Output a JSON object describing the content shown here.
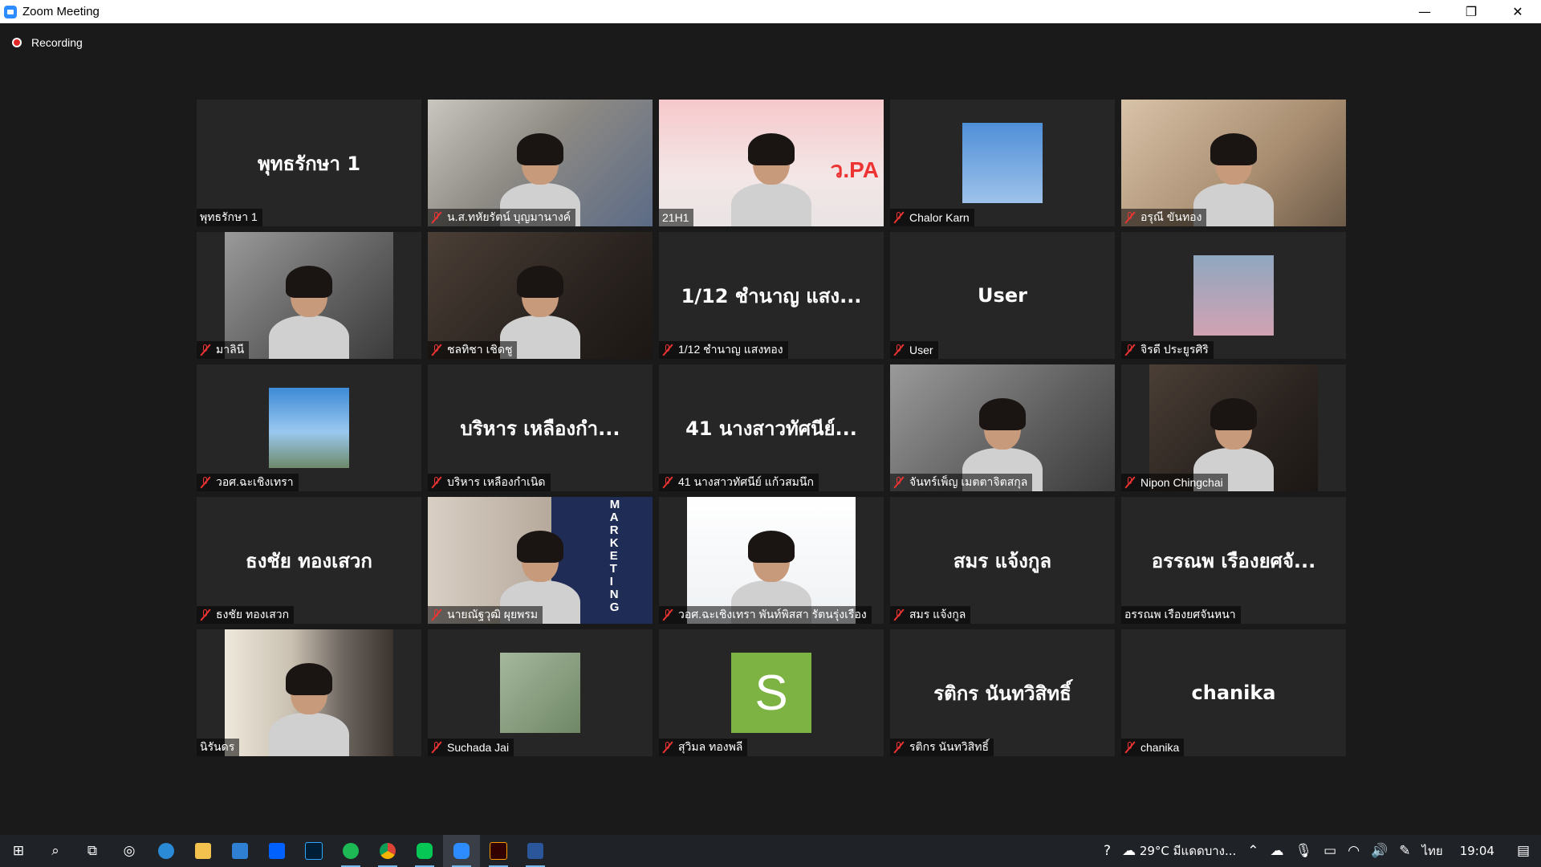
{
  "window": {
    "title": "Zoom Meeting",
    "minimize": "—",
    "restore": "❐",
    "close": "✕"
  },
  "recording": {
    "label": "Recording"
  },
  "tiles": [
    {
      "display": "พุทธรักษา 1",
      "label": "พุทธรักษา 1",
      "muted": false,
      "type": "name"
    },
    {
      "display": "",
      "label": "น.ส.ทหัยรัตน์ บุญมานางค์",
      "muted": true,
      "type": "video",
      "style": "v-room"
    },
    {
      "display": "",
      "label": "21H1",
      "muted": false,
      "type": "video",
      "style": "v-pink",
      "active": true,
      "slide_text": "ว.PA"
    },
    {
      "display": "",
      "label": "Chalor Karn",
      "muted": true,
      "type": "avatar",
      "style": "v-blue"
    },
    {
      "display": "",
      "label": "อรุณี ขันทอง",
      "muted": true,
      "type": "video",
      "style": "v-warm"
    },
    {
      "display": "",
      "label": "มาลินี",
      "muted": true,
      "type": "video",
      "style": "v-grey",
      "narrow": true
    },
    {
      "display": "",
      "label": "ชลทิชา เชิดชู",
      "muted": true,
      "type": "video",
      "style": "v-dark"
    },
    {
      "display": "1/12 ชำนาญ แสง...",
      "label": "1/12 ชำนาญ แสงทอง",
      "muted": true,
      "type": "name"
    },
    {
      "display": "User",
      "label": "User",
      "muted": true,
      "type": "name"
    },
    {
      "display": "",
      "label": "จิรดี ประยูรศิริ",
      "muted": true,
      "type": "avatar",
      "style": "v-pic"
    },
    {
      "display": "",
      "label": "วอศ.ฉะเชิงเทรา",
      "muted": true,
      "type": "avatar",
      "style": "v-campus"
    },
    {
      "display": "บริหาร เหลืองกำ...",
      "label": "บริหาร เหลืองกำเนิด",
      "muted": true,
      "type": "name"
    },
    {
      "display": "41 นางสาวทัศนีย์...",
      "label": "41 นางสาวทัศนีย์ แก้วสมนึก",
      "muted": true,
      "type": "name"
    },
    {
      "display": "",
      "label": "จันทร์เพ็ญ เมตตาจิตสกุล",
      "muted": true,
      "type": "video",
      "style": "v-grey"
    },
    {
      "display": "",
      "label": "Nipon Chingchai",
      "muted": true,
      "type": "video",
      "style": "v-dark",
      "narrow": true
    },
    {
      "display": "ธงชัย ทองเสวก",
      "label": "ธงชัย ทองเสวก",
      "muted": true,
      "type": "name"
    },
    {
      "display": "",
      "label": "นายณัฐวุฒิ ผุยพรม",
      "muted": true,
      "type": "video",
      "style": "v-navy",
      "mkt": "MARKETING"
    },
    {
      "display": "",
      "label": "วอศ.ฉะเชิงเทรา พันท์พิสสา รัตนรุ่งเรือง",
      "muted": true,
      "type": "video",
      "style": "v-white",
      "narrow": true
    },
    {
      "display": "สมร แจ้งกูล",
      "label": "สมร แจ้งกูล",
      "muted": true,
      "type": "name"
    },
    {
      "display": "อรรณพ เรืองยศจั...",
      "label": "อรรณพ เรืองยศจันหนา",
      "muted": false,
      "type": "name"
    },
    {
      "display": "",
      "label": "นิรันดร",
      "muted": false,
      "type": "video",
      "style": "v-curtain",
      "narrow": true
    },
    {
      "display": "",
      "label": "Suchada Jai",
      "muted": true,
      "type": "avatar",
      "style": "v-green"
    },
    {
      "display": "S",
      "label": "สุวิมล ทองพลี",
      "muted": true,
      "type": "letter"
    },
    {
      "display": "รติกร นันทวิสิทธิ์",
      "label": "รติกร นันทวิสิทธิ์",
      "muted": true,
      "type": "name"
    },
    {
      "display": "chanika",
      "label": "chanika",
      "muted": true,
      "type": "name"
    }
  ],
  "taskbar": {
    "apps": [
      "start",
      "search",
      "task-view",
      "cortana",
      "edge",
      "file-explorer",
      "mail",
      "dropbox",
      "photoshop",
      "spotify",
      "chrome",
      "line",
      "zoom",
      "illustrator",
      "word"
    ],
    "weather": "29°C มีแดดบาง...",
    "language": "ไทย",
    "time": "19:04"
  },
  "colors": {
    "active_speaker": "#dcea6a",
    "muted_icon": "#ee3333",
    "zoom_blue": "#2D8CFF"
  }
}
